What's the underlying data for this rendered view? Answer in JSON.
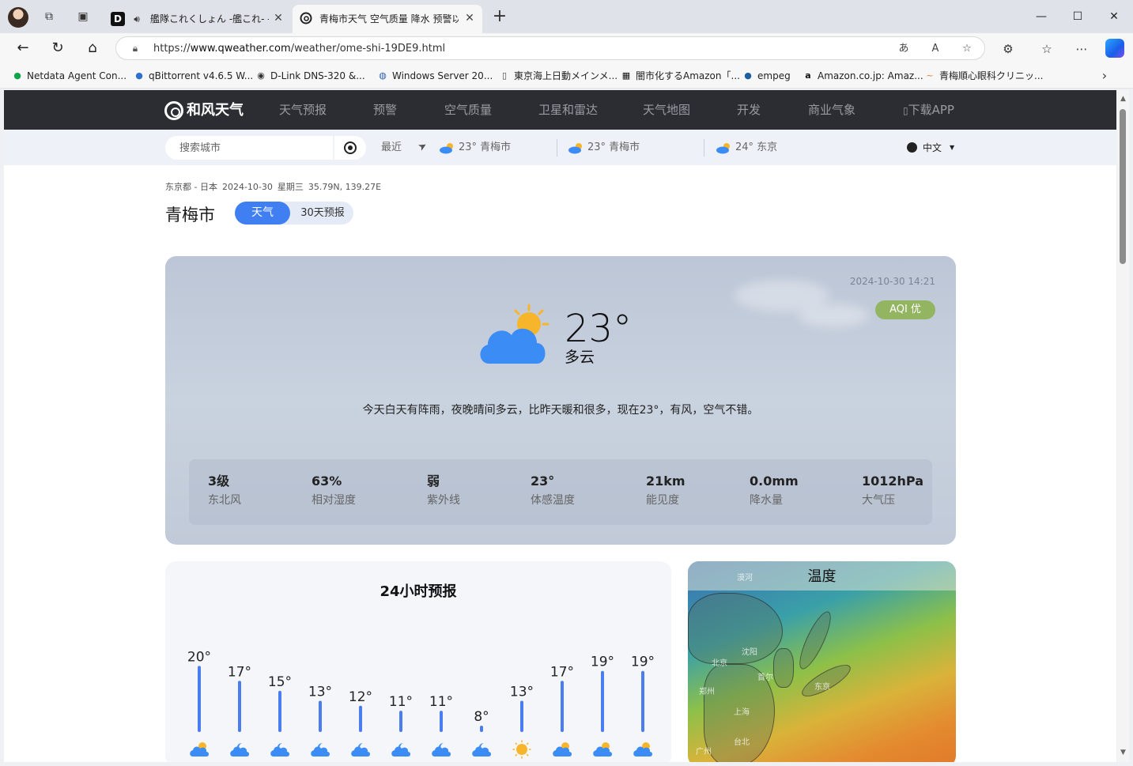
{
  "browser": {
    "tabs": [
      {
        "title": "艦隊これくしょん -艦これ- - オンラ",
        "favicon": "D"
      },
      {
        "title": "青梅市天气 空气质量 降水 预警以",
        "favicon": "qweather-icon"
      }
    ],
    "url": {
      "prefix": "https://",
      "host": "www.qweather.com",
      "path": "/weather/ome-shi-19DE9.html"
    },
    "bookmarks": [
      {
        "label": "Netdata Agent Con..."
      },
      {
        "label": "qBittorrent v4.6.5 W..."
      },
      {
        "label": "D-Link DNS-320 &..."
      },
      {
        "label": "Windows Server 20..."
      },
      {
        "label": "東京海上日動メインメ..."
      },
      {
        "label": "闇市化するAmazon「..."
      },
      {
        "label": "empeg"
      },
      {
        "label": "Amazon.co.jp: Amaz..."
      },
      {
        "label": "青梅順心眼科クリニッ..."
      }
    ]
  },
  "site": {
    "logo": "和风天气",
    "nav": [
      "天气预报",
      "预警",
      "空气质量",
      "卫星和雷达",
      "天气地图",
      "开发",
      "商业气象",
      "下载APP"
    ],
    "search": {
      "placeholder": "搜索城市",
      "recent_label": "最近",
      "recent": [
        "23° 青梅市",
        "23° 青梅市",
        "24° 东京"
      ],
      "lang": "中文"
    }
  },
  "location": {
    "region": "东京都 - 日本",
    "date": "2024-10-30",
    "weekday": "星期三",
    "coords": "35.79N, 139.27E",
    "city": "青梅市",
    "tabs": [
      "天气",
      "30天预报"
    ]
  },
  "current": {
    "time": "2024-10-30 14:21",
    "aqi": "AQI 优",
    "temp": "23°",
    "desc": "多云",
    "summary": "今天白天有阵雨，夜晚晴间多云，比昨天暖和很多，现在23°，有风，空气不错。",
    "stats": [
      {
        "value": "3级",
        "label": "东北风"
      },
      {
        "value": "63%",
        "label": "相对湿度"
      },
      {
        "value": "弱",
        "label": "紫外线"
      },
      {
        "value": "23°",
        "label": "体感温度"
      },
      {
        "value": "21km",
        "label": "能见度"
      },
      {
        "value": "0.0mm",
        "label": "降水量"
      },
      {
        "value": "1012hPa",
        "label": "大气压"
      }
    ],
    "colors": {
      "accent": "#3f7ff2",
      "aqi_good": "#93b562"
    }
  },
  "hourly": {
    "title": "24小时预报",
    "temps": [
      20,
      17,
      15,
      13,
      12,
      11,
      11,
      8,
      13,
      17,
      19,
      19
    ],
    "icons": [
      "partly-cloudy-icon",
      "cloudy-night-icon",
      "cloudy-night-icon",
      "cloudy-night-icon",
      "cloudy-night-icon",
      "cloudy-night-icon",
      "cloudy-night-icon",
      "cloudy-night-icon",
      "sunny-icon",
      "partly-cloudy-icon",
      "partly-cloudy-icon",
      "partly-cloudy-icon"
    ],
    "bar_color": "#4a7df0"
  },
  "map": {
    "title": "温度",
    "cities": [
      "漠河",
      "北京",
      "沈阳",
      "首尔",
      "东京",
      "郑州",
      "上海",
      "台北",
      "广州"
    ]
  }
}
